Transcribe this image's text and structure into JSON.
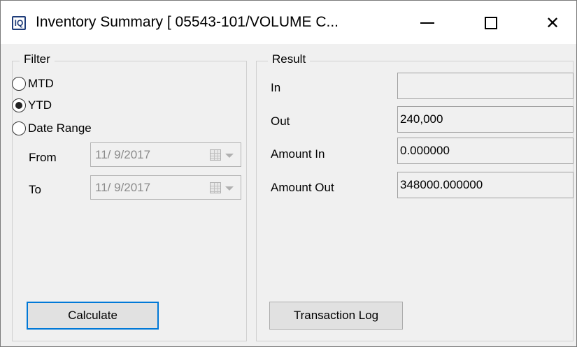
{
  "window": {
    "app_icon_text": "IQ",
    "title": "Inventory Summary [ 05543-101/VOLUME C...",
    "close_glyph": "✕"
  },
  "filter": {
    "legend": "Filter",
    "options": [
      {
        "label": "MTD",
        "checked": false
      },
      {
        "label": "YTD",
        "checked": true
      },
      {
        "label": "Date Range",
        "checked": false
      }
    ],
    "from_label": "From",
    "from_value": "11/ 9/2017",
    "to_label": "To",
    "to_value": "11/ 9/2017",
    "calculate_label": "Calculate"
  },
  "result": {
    "legend": "Result",
    "in_label": "In",
    "in_value": "",
    "out_label": "Out",
    "out_value": "240,000",
    "amount_in_label": "Amount In",
    "amount_in_value": "0.000000",
    "amount_out_label": "Amount Out",
    "amount_out_value": "348000.000000",
    "transaction_log_label": "Transaction Log"
  },
  "colors": {
    "accent": "#0078d7",
    "window_bg": "#f0f0f0",
    "icon_blue": "#1f3d7a"
  }
}
